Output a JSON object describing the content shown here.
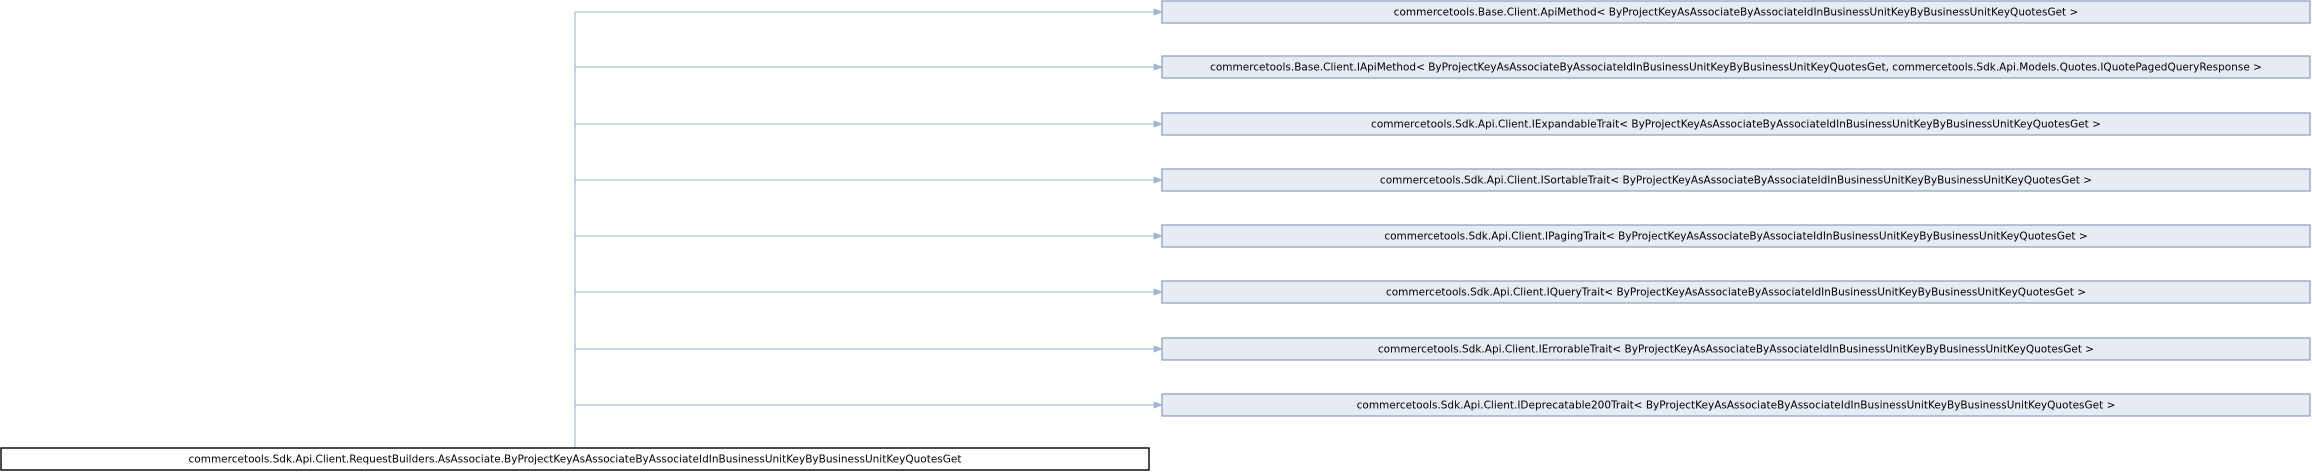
{
  "diagram": {
    "main_class": "commercetools.Sdk.Api.Client.RequestBuilders.AsAssociate.ByProjectKeyAsAssociateByAssociateIdInBusinessUnitKeyByBusinessUnitKeyQuotesGet",
    "bases": [
      "commercetools.Base.Client.ApiMethod< ByProjectKeyAsAssociateByAssociateIdInBusinessUnitKeyByBusinessUnitKeyQuotesGet >",
      "commercetools.Base.Client.IApiMethod< ByProjectKeyAsAssociateByAssociateIdInBusinessUnitKeyByBusinessUnitKeyQuotesGet, commercetools.Sdk.Api.Models.Quotes.IQuotePagedQueryResponse >",
      "commercetools.Sdk.Api.Client.IExpandableTrait< ByProjectKeyAsAssociateByAssociateIdInBusinessUnitKeyByBusinessUnitKeyQuotesGet >",
      "commercetools.Sdk.Api.Client.ISortableTrait< ByProjectKeyAsAssociateByAssociateIdInBusinessUnitKeyByBusinessUnitKeyQuotesGet >",
      "commercetools.Sdk.Api.Client.IPagingTrait< ByProjectKeyAsAssociateByAssociateIdInBusinessUnitKeyByBusinessUnitKeyQuotesGet >",
      "commercetools.Sdk.Api.Client.IQueryTrait< ByProjectKeyAsAssociateByAssociateIdInBusinessUnitKeyByBusinessUnitKeyQuotesGet >",
      "commercetools.Sdk.Api.Client.IErrorableTrait< ByProjectKeyAsAssociateByAssociateIdInBusinessUnitKeyByBusinessUnitKeyQuotesGet >",
      "commercetools.Sdk.Api.Client.IDeprecatable200Trait< ByProjectKeyAsAssociateByAssociateIdInBusinessUnitKeyByBusinessUnitKeyQuotesGet >"
    ]
  }
}
